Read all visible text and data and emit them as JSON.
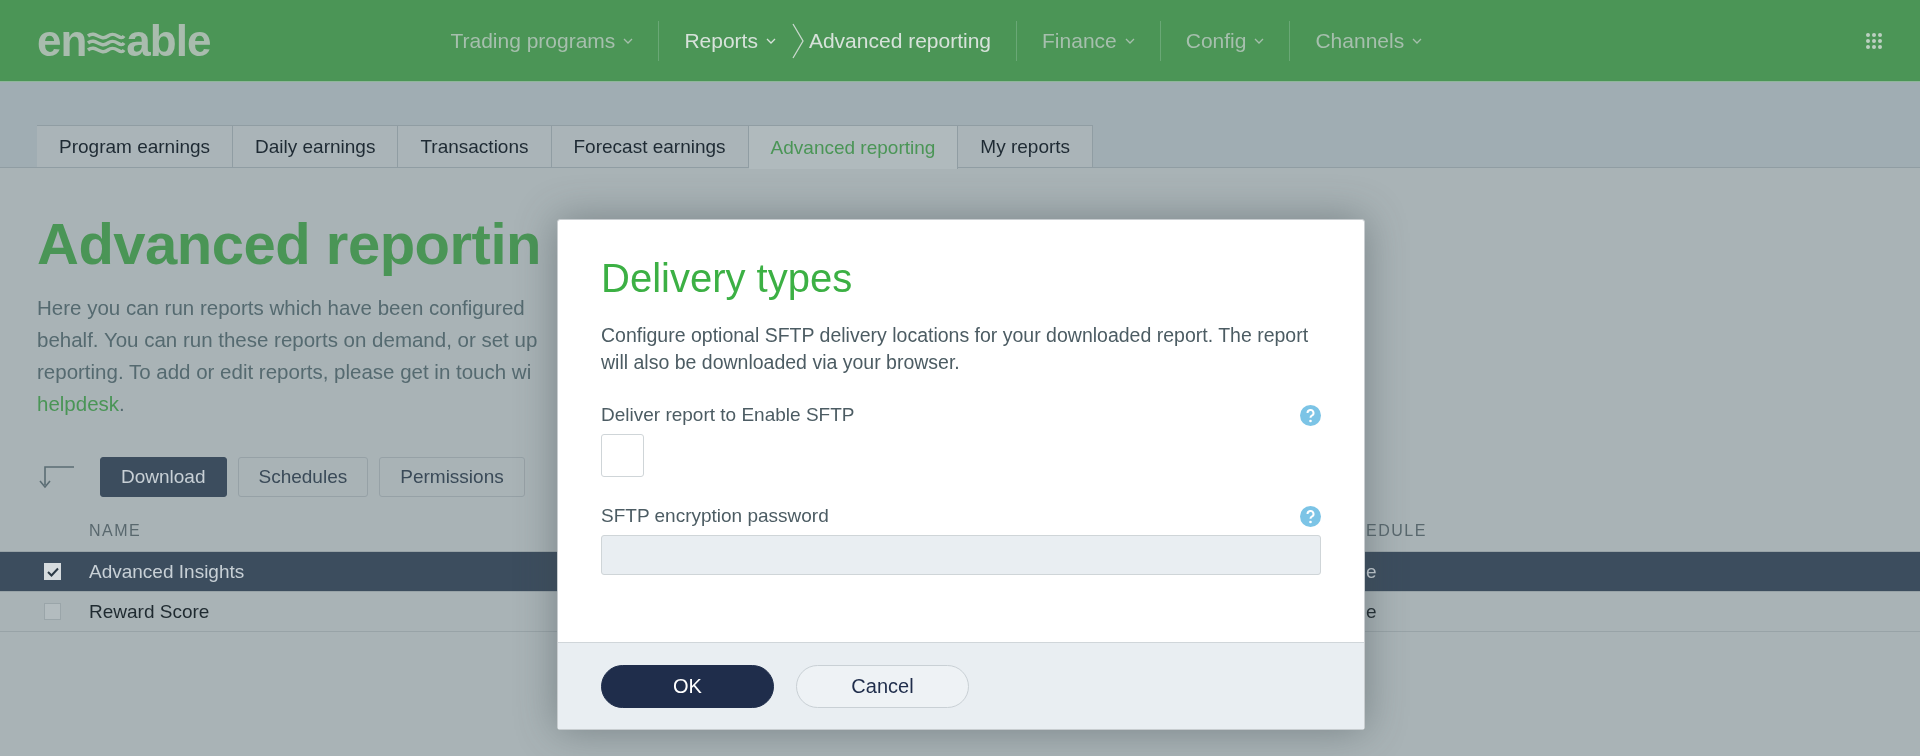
{
  "header": {
    "logo": {
      "left": "en",
      "right": "able"
    },
    "nav": [
      {
        "label": "Trading programs",
        "kind": "menu",
        "active": false
      },
      {
        "label": "Reports",
        "kind": "menu",
        "active": true
      },
      {
        "label": "Advanced reporting",
        "kind": "crumb",
        "active": true
      },
      {
        "label": "Finance",
        "kind": "menu",
        "active": false
      },
      {
        "label": "Config",
        "kind": "menu",
        "active": false
      },
      {
        "label": "Channels",
        "kind": "menu",
        "active": false
      }
    ]
  },
  "tabs": [
    {
      "label": "Program earnings",
      "selected": false
    },
    {
      "label": "Daily earnings",
      "selected": false
    },
    {
      "label": "Transactions",
      "selected": false
    },
    {
      "label": "Forecast earnings",
      "selected": false
    },
    {
      "label": "Advanced reporting",
      "selected": true
    },
    {
      "label": "My reports",
      "selected": false
    }
  ],
  "page": {
    "title": "Advanced reportin",
    "intro": {
      "lines": [
        "Here you can run reports which have been configured",
        "behalf. You can run these reports on demand, or set up",
        "reporting. To add or edit reports, please get in touch wi"
      ],
      "link": "helpdesk",
      "after_link": "."
    },
    "toolbar": [
      {
        "label": "Download",
        "kind": "primary"
      },
      {
        "label": "Schedules",
        "kind": "outline"
      },
      {
        "label": "Permissions",
        "kind": "outline"
      }
    ],
    "table": {
      "columns": [
        "NAME",
        "EDULE"
      ],
      "rows": [
        {
          "cells": [
            "Advanced Insights",
            "e"
          ],
          "selected": true
        },
        {
          "cells": [
            "Reward Score",
            "e"
          ],
          "selected": false
        }
      ]
    }
  },
  "dialog": {
    "title": "Delivery types",
    "description": "Configure optional SFTP delivery locations for your downloaded report. The report will also be downloaded via your browser.",
    "fields": [
      {
        "label": "Deliver report to Enable SFTP",
        "kind": "checkbox",
        "checked": false
      },
      {
        "label": "SFTP encryption password",
        "kind": "text"
      }
    ],
    "buttons": [
      {
        "label": "OK",
        "kind": "primary"
      },
      {
        "label": "Cancel",
        "kind": "secondary"
      }
    ]
  }
}
